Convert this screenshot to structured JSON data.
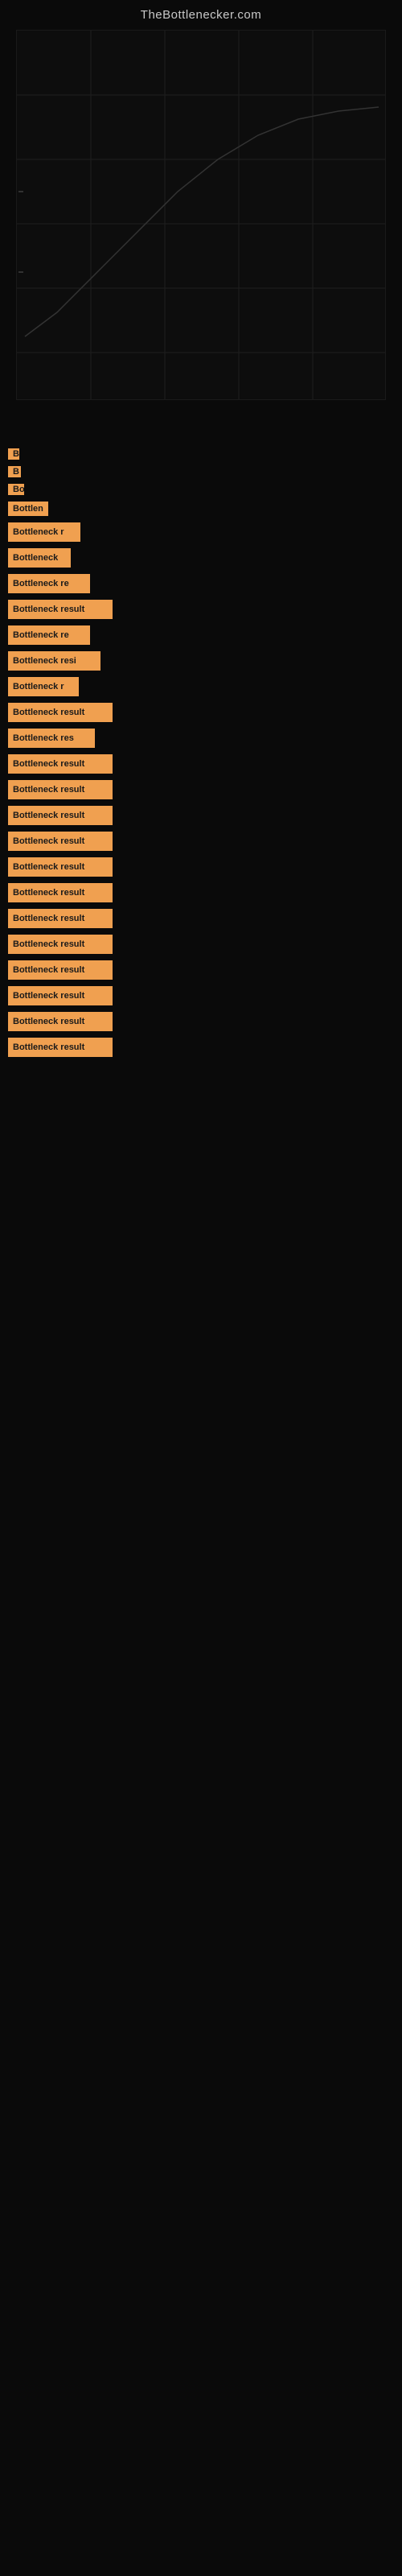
{
  "site": {
    "title": "TheBottlenecker.com"
  },
  "bottleneck_items": [
    {
      "id": 1,
      "label": "B",
      "width": 14
    },
    {
      "id": 2,
      "label": "B",
      "width": 16
    },
    {
      "id": 3,
      "label": "Bo",
      "width": 20
    },
    {
      "id": 4,
      "label": "Bottlen",
      "width": 50
    },
    {
      "id": 5,
      "label": "Bottleneck r",
      "width": 90
    },
    {
      "id": 6,
      "label": "Bottleneck",
      "width": 78
    },
    {
      "id": 7,
      "label": "Bottleneck re",
      "width": 102
    },
    {
      "id": 8,
      "label": "Bottleneck result",
      "width": 130
    },
    {
      "id": 9,
      "label": "Bottleneck re",
      "width": 102
    },
    {
      "id": 10,
      "label": "Bottleneck resi",
      "width": 115
    },
    {
      "id": 11,
      "label": "Bottleneck r",
      "width": 88
    },
    {
      "id": 12,
      "label": "Bottleneck result",
      "width": 130
    },
    {
      "id": 13,
      "label": "Bottleneck res",
      "width": 108
    },
    {
      "id": 14,
      "label": "Bottleneck result",
      "width": 130
    },
    {
      "id": 15,
      "label": "Bottleneck result",
      "width": 130
    },
    {
      "id": 16,
      "label": "Bottleneck result",
      "width": 130
    },
    {
      "id": 17,
      "label": "Bottleneck result",
      "width": 130
    },
    {
      "id": 18,
      "label": "Bottleneck result",
      "width": 130
    },
    {
      "id": 19,
      "label": "Bottleneck result",
      "width": 130
    },
    {
      "id": 20,
      "label": "Bottleneck result",
      "width": 130
    },
    {
      "id": 21,
      "label": "Bottleneck result",
      "width": 130
    },
    {
      "id": 22,
      "label": "Bottleneck result",
      "width": 130
    },
    {
      "id": 23,
      "label": "Bottleneck result",
      "width": 130
    },
    {
      "id": 24,
      "label": "Bottleneck result",
      "width": 130
    },
    {
      "id": 25,
      "label": "Bottleneck result",
      "width": 130
    }
  ]
}
